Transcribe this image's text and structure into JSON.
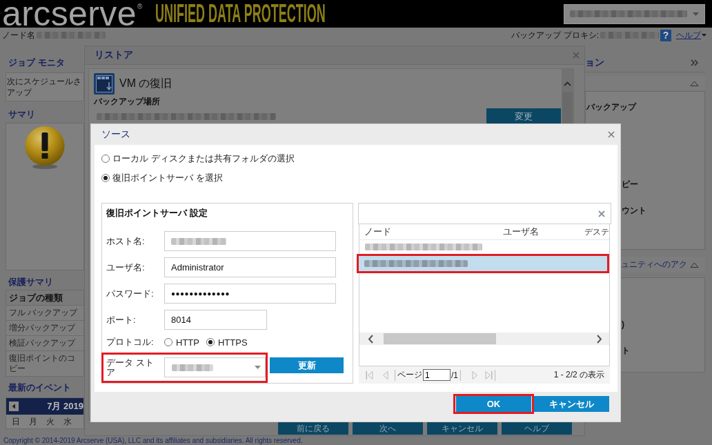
{
  "header": {
    "logo": "arcserve$^{®}$",
    "product": "UNIFIED DATA PROTECTION",
    "server_select": {
      "redacted": true
    }
  },
  "subheader": {
    "node": {
      "label": "ノード名",
      "redacted": true
    },
    "proxy": {
      "label": "バックアップ プロキシ:",
      "redacted": true
    },
    "help_button": "?",
    "help_link": "ヘルプ"
  },
  "left_panel": {
    "job_monitor": {
      "title": "ジョブ モニタ",
      "lines": [
        "次にスケジュールさ",
        "アップ"
      ]
    },
    "summary": {
      "title": "サマリ"
    },
    "protection_summary": {
      "title": "保護サマリ",
      "column": "ジョブの種類",
      "rows": [
        "フル バックアップ",
        "増分バックアップ",
        "検証バックアップ",
        "復旧ポイントのコピー"
      ]
    },
    "recent_events": {
      "title": "最新のイベント",
      "calendar": {
        "month": "7月 2019",
        "weekdays": [
          "日",
          "月",
          "火",
          "水"
        ]
      }
    }
  },
  "right_panel": {
    "title": "ョン",
    "sections": [
      {
        "items": [
          "バックアップ",
          "ピー",
          "ウント"
        ]
      },
      {
        "title": "ュニティへのアク",
        "items": [
          ")",
          "ト"
        ]
      }
    ]
  },
  "footer": {
    "copyright": "Copyright © 2014-2019 Arcserve (USA), LLC and its affiliates and subsidiaries. All rights reserved."
  },
  "restore_dialog": {
    "title": "リストア",
    "heading": "VM の復旧",
    "section": "バックアップ場所",
    "location": {
      "redacted": true
    },
    "change_button": "変更",
    "buttons": [
      "前に戻る",
      "次へ",
      "キャンセル",
      "ヘルプ"
    ]
  },
  "source_dialog": {
    "title": "ソース",
    "source_options": [
      {
        "label": "ローカル ディスクまたは共有フォルダの選択",
        "selected": false
      },
      {
        "label": "復旧ポイントサーバ を選択",
        "selected": true
      }
    ],
    "settings": {
      "title": "復旧ポイントサーバ 設定",
      "fields": [
        {
          "kind": "text",
          "label": "ホスト名:",
          "redacted": true,
          "highlighted": false
        },
        {
          "kind": "text",
          "label": "ユーザ名:",
          "value": "Administrator",
          "highlighted": false
        },
        {
          "kind": "password",
          "label": "パスワード:",
          "value": "●●●●●●●●●●●●●",
          "highlighted": false
        },
        {
          "kind": "port",
          "label": "ポート:",
          "value": "8014",
          "highlighted": false
        },
        {
          "kind": "radio",
          "label": "プロトコル:",
          "options": [
            {
              "label": "HTTP",
              "selected": false
            },
            {
              "label": "HTTPS",
              "selected": true
            }
          ],
          "highlighted": false
        },
        {
          "kind": "select",
          "label": "データ ストア",
          "redacted": true,
          "highlighted": true
        }
      ],
      "refresh_button": "更新"
    },
    "server_list": {
      "columns": [
        "ノード",
        "ユーザ名",
        "デステ"
      ],
      "rows": [
        {
          "redacted": true,
          "selected": false,
          "highlighted": false
        },
        {
          "redacted": true,
          "selected": true,
          "highlighted": true
        }
      ],
      "pager": {
        "first": {
          "disabled": true
        },
        "prev": {
          "disabled": true
        },
        "page_label": "ページ",
        "page": "1",
        "page_count": "/1",
        "next": {
          "disabled": true
        },
        "last": {
          "disabled": true
        },
        "summary": "1 - 2/2 の表示"
      }
    },
    "buttons": [
      {
        "label": "OK",
        "highlighted": true
      },
      {
        "label": "キャンセル",
        "highlighted": false
      }
    ]
  }
}
